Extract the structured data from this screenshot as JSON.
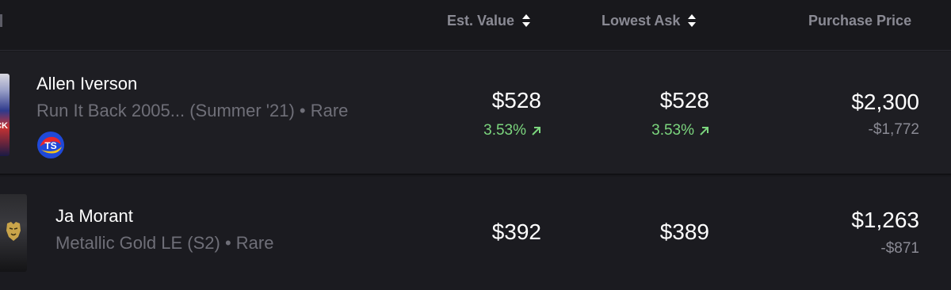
{
  "columns": {
    "est_value": "Est. Value",
    "lowest_ask": "Lowest Ask",
    "purchase_price": "Purchase Price"
  },
  "rows": [
    {
      "player": "Allen Iverson",
      "set": "Run It Back 2005... (Summer '21) • Rare",
      "thumb_text": "ACK",
      "badge_text": "TS",
      "est_value": "$528",
      "est_change": "3.53%",
      "lowest_ask": "$528",
      "ask_change": "3.53%",
      "purchase_price": "$2,300",
      "purchase_diff": "-$1,772"
    },
    {
      "player": "Ja Morant",
      "set": "Metallic Gold LE (S2) • Rare",
      "est_value": "$392",
      "lowest_ask": "$389",
      "purchase_price": "$1,263",
      "purchase_diff": "-$871"
    }
  ],
  "colors": {
    "background": "#18181c",
    "row_background": "#1e1e23",
    "positive": "#7cd67e",
    "muted": "#8a8a94"
  }
}
